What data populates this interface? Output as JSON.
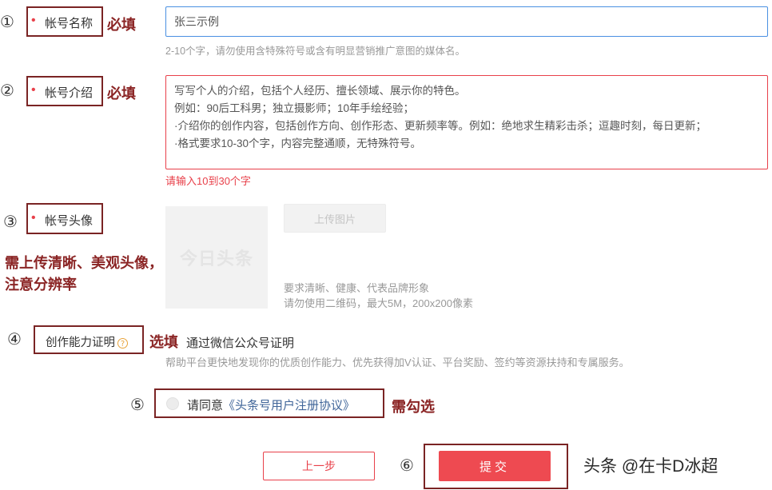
{
  "steps": [
    "①",
    "②",
    "③",
    "④",
    "⑤",
    "⑥"
  ],
  "account_name": {
    "label": "帐号名称",
    "required_mark": "•",
    "annotation": "必填",
    "input_value": "张三示例",
    "hint": "2-10个字，请勿使用含特殊符号或含有明显营销推广意图的媒体名。"
  },
  "account_intro": {
    "label": "帐号介绍",
    "required_mark": "•",
    "annotation": "必填",
    "lines": [
      "写写个人的介绍，包括个人经历、擅长领域、展示你的特色。",
      "例如：90后工科男；独立摄影师；10年手绘经验；",
      "·介绍你的创作内容，包括创作方向、创作形态、更新频率等。例如：绝地求生精彩击杀；逗趣时刻，每日更新；",
      "·格式要求10-30个字，内容完整通顺，无特殊符号。"
    ],
    "error": "请输入10到30个字"
  },
  "avatar": {
    "label": "帐号头像",
    "required_mark": "•",
    "annotation_line1": "需上传清晰、美观头像，",
    "annotation_line2": "注意分辨率",
    "placeholder_logo": "今日头条",
    "upload_label": "上传图片",
    "hint_line1": "要求清晰、健康、代表品牌形象",
    "hint_line2": "请勿使用二维码，最大5M，200x200像素"
  },
  "certification": {
    "label": "创作能力证明",
    "help_icon": "?",
    "annotation": "选填",
    "option": "通过微信公众号证明",
    "hint": "帮助平台更快地发现你的优质创作能力、优先获得加V认证、平台奖励、签约等资源扶持和专属服务。"
  },
  "agreement": {
    "prefix": "请同意",
    "link": "《头条号用户注册协议》",
    "annotation": "需勾选"
  },
  "buttons": {
    "prev": "上一步",
    "submit": "提交"
  },
  "watermark": "头条 @在卡D冰超",
  "colors": {
    "accent_red": "#e8404a",
    "annotation_dark_red": "#7a2424",
    "input_focus_blue": "#4a90e2",
    "link_blue": "#406599"
  }
}
